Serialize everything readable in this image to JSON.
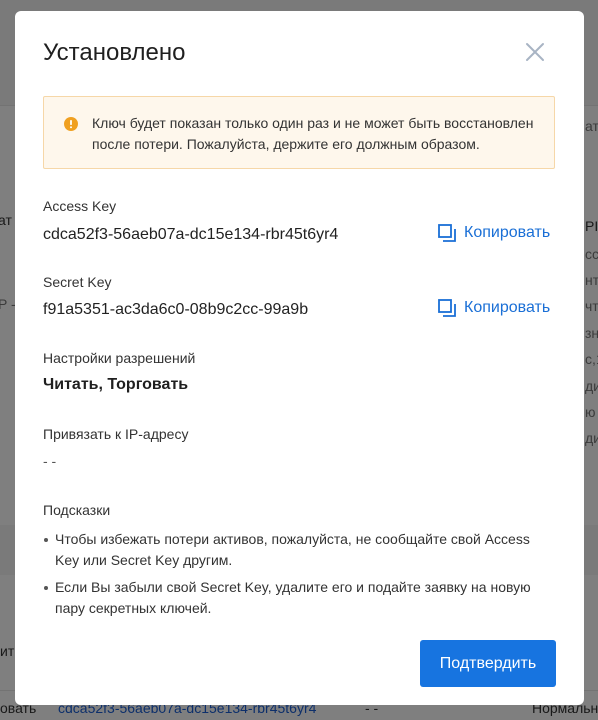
{
  "modal": {
    "title": "Установлено",
    "warning_text": "Ключ будет показан только один раз и не может быть восстановлен после потери. Пожалуйста, держите его должным образом.",
    "access_key": {
      "label": "Access Key",
      "value": "cdca52f3-56aeb07a-dc15e134-rbr45t6yr4",
      "copy_label": "Копировать"
    },
    "secret_key": {
      "label": "Secret Key",
      "value": "f91a5351-ac3da6c0-08b9c2cc-99a9b",
      "copy_label": "Копировать"
    },
    "permissions": {
      "label": "Настройки разрешений",
      "value": "Читать, Торговать"
    },
    "ip_binding": {
      "label": "Привязать к IP-адресу",
      "value": "- -"
    },
    "hints": {
      "label": "Подсказки",
      "items": [
        "Чтобы избежать потери активов, пожалуйста, не сообщайте свой Access Key или Secret Key другим.",
        "Если Вы забыли свой Secret Key, удалите его и подайте заявку на новую пару секретных ключей."
      ]
    },
    "confirm_label": "Подтвердить"
  },
  "background": {
    "left_fragments": [
      "ат",
      "P -",
      "ит",
      "овать"
    ],
    "right_fragments": [
      "ать",
      "PI",
      "сс",
      "нта",
      "чти",
      "зн",
      "c,1",
      "ди",
      "ю",
      "ди",
      "Нормальн"
    ],
    "bottom_key": "cdca52f3-56aeb07a-dc15e134-rbr45t6yr4",
    "bottom_dashes": "- -"
  },
  "colors": {
    "accent": "#1774e0",
    "link": "#1a6fd6",
    "warning_bg": "#fef7ec",
    "warning_icon": "#f0a020"
  },
  "icons": {
    "close": "close-icon",
    "warning": "warning-icon",
    "copy": "copy-icon"
  }
}
